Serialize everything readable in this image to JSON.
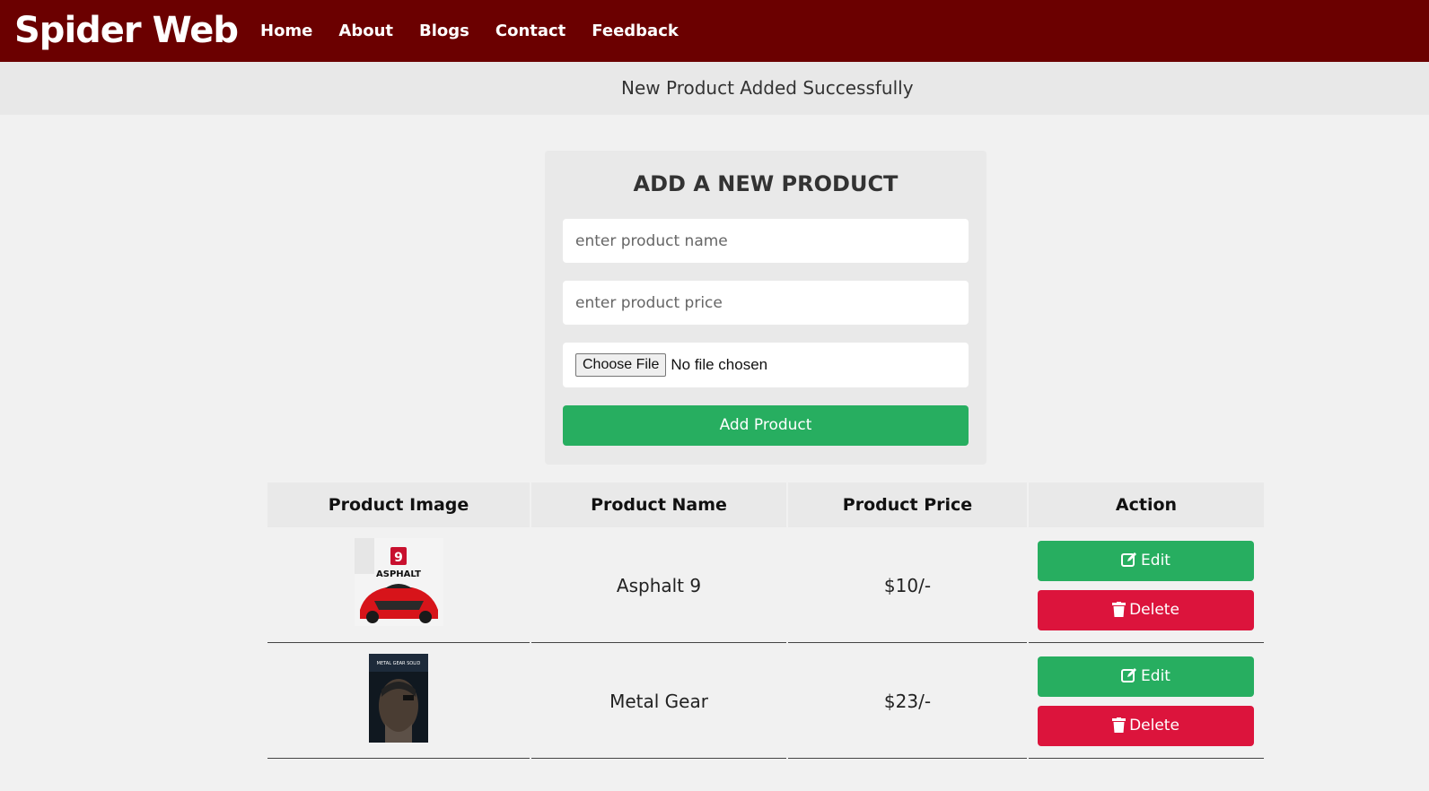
{
  "header": {
    "logo": "Spider Web",
    "nav": [
      "Home",
      "About",
      "Blogs",
      "Contact",
      "Feedback"
    ]
  },
  "message": "New Product Added Successfully",
  "form": {
    "title": "ADD A NEW PRODUCT",
    "name_placeholder": "enter product name",
    "price_placeholder": "enter product price",
    "choose_file_label": "Choose File",
    "no_file_text": "No file chosen",
    "submit_label": "Add Product"
  },
  "table": {
    "headers": [
      "Product Image",
      "Product Name",
      "Product Price",
      "Action"
    ],
    "rows": [
      {
        "name": "Asphalt 9",
        "price": "$10/-",
        "edit_label": "Edit",
        "delete_label": "Delete",
        "image": "asphalt-9-cover"
      },
      {
        "name": "Metal Gear",
        "price": "$23/-",
        "edit_label": "Edit",
        "delete_label": "Delete",
        "image": "metal-gear-cover"
      }
    ]
  },
  "colors": {
    "header_bg": "#6b0000",
    "success_green": "#27ae60",
    "delete_red": "#dc143c"
  }
}
